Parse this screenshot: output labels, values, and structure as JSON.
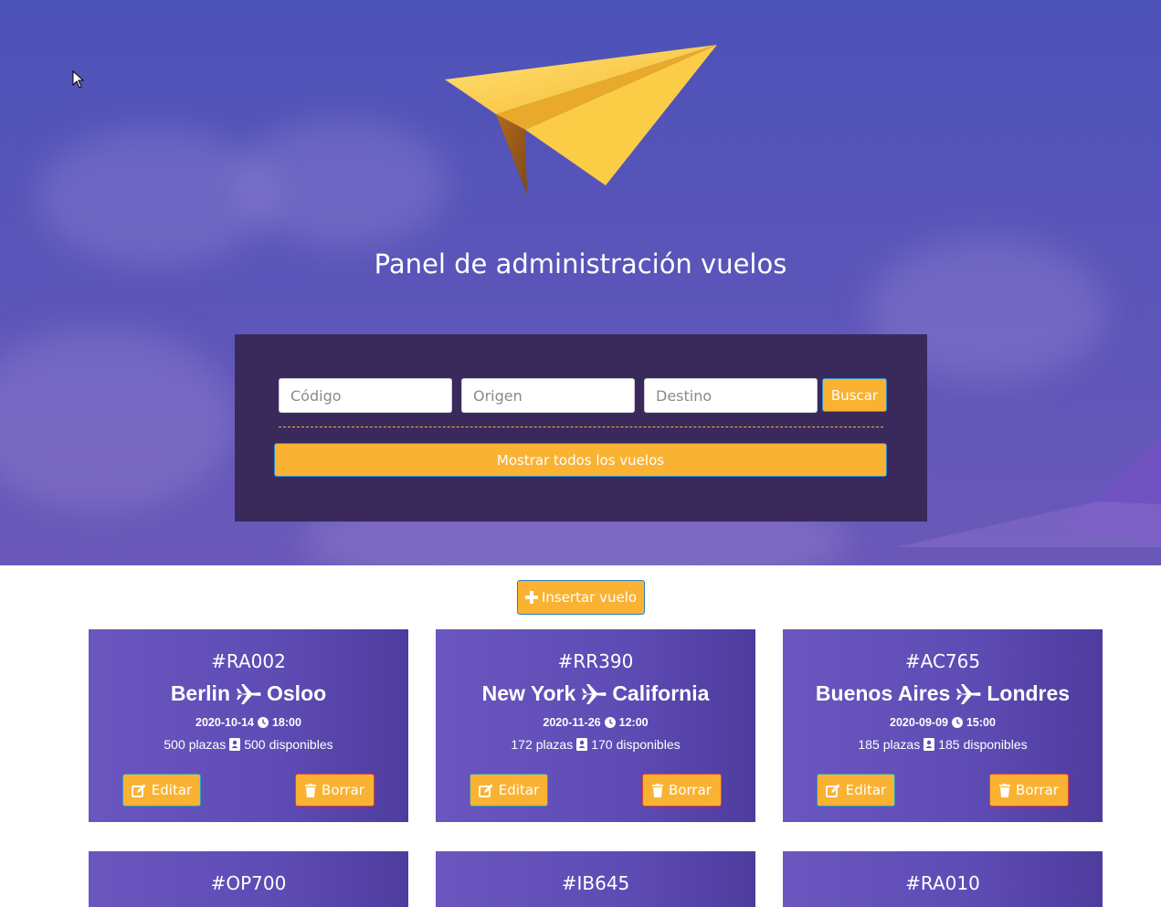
{
  "hero": {
    "title": "Panel de administración vuelos"
  },
  "search": {
    "code_placeholder": "Código",
    "origin_placeholder": "Origen",
    "destination_placeholder": "Destino",
    "search_label": "Buscar",
    "show_all_label": "Mostrar todos los vuelos"
  },
  "insert": {
    "label": "Insertar vuelo"
  },
  "labels": {
    "plazas": "plazas",
    "disponibles": "disponibles",
    "edit": "Editar",
    "delete": "Borrar"
  },
  "flights": [
    {
      "code": "#RA002",
      "origin": "Berlin",
      "destination": "Osloo",
      "date": "2020-10-14",
      "time": "18:00",
      "seats": "500",
      "available": "500"
    },
    {
      "code": "#RR390",
      "origin": "New York",
      "destination": "California",
      "date": "2020-11-26",
      "time": "12:00",
      "seats": "172",
      "available": "170"
    },
    {
      "code": "#AC765",
      "origin": "Buenos Aires",
      "destination": "Londres",
      "date": "2020-09-09",
      "time": "15:00",
      "seats": "185",
      "available": "185"
    },
    {
      "code": "#OP700"
    },
    {
      "code": "#IB645"
    },
    {
      "code": "#RA010"
    }
  ],
  "colors": {
    "accent": "#f9b232",
    "panel": "#3a2a5c",
    "hero": "#5a55b9",
    "card": "#5e4bb4"
  }
}
